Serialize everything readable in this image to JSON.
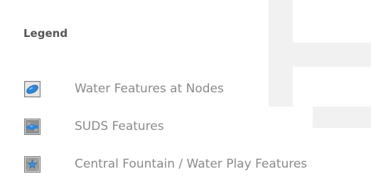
{
  "legend": {
    "title": "Legend",
    "items": [
      {
        "label": "Water Features at Nodes",
        "icon": "water-node-icon",
        "color": "#2e86d6"
      },
      {
        "label": "SUDS Features",
        "icon": "suds-icon",
        "color": "#2e86d6"
      },
      {
        "label": "Central Fountain / Water Play Features",
        "icon": "fountain-star-icon",
        "color": "#3a8fe0"
      }
    ]
  }
}
